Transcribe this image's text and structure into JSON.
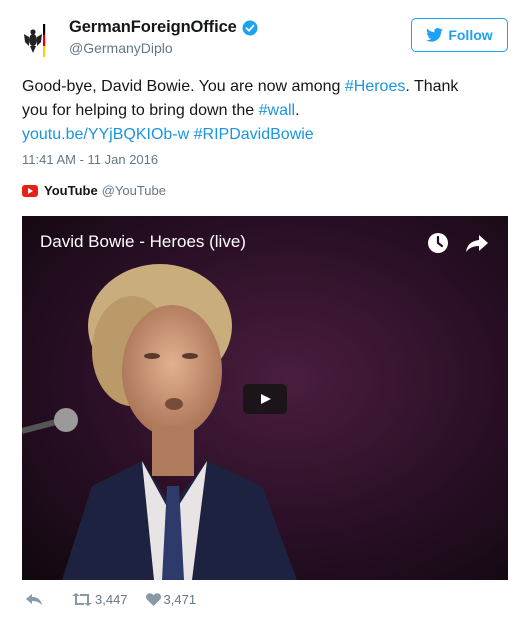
{
  "user": {
    "display_name": "GermanForeignOffice",
    "handle": "@GermanyDiplo",
    "avatar_icon": "eagle-coat-of-arms-icon",
    "verified_icon": "verified-badge-icon"
  },
  "follow_button": {
    "label": "Follow",
    "icon": "twitter-bird-icon"
  },
  "tweet": {
    "line1_text": "Good-bye, David Bowie. You are now among ",
    "line1_hashtag": "#Heroes",
    "line1_tail": ". Thank",
    "line2_text": "you for helping to bring down the ",
    "line2_hashtag": "#wall",
    "line2_tail": ".",
    "line3_link": "youtu.be/YYjBQKIOb-w",
    "line3_hashtag": "#RIPDavidBowie",
    "timestamp": "11:41 AM - 11 Jan 2016"
  },
  "embed": {
    "source_name": "YouTube",
    "source_handle": "@YouTube",
    "video_title": "David Bowie - Heroes (live)",
    "icons": [
      "youtube-logo-icon",
      "clock-icon",
      "share-arrow-icon",
      "play-icon"
    ]
  },
  "actions": {
    "retweets": "3,447",
    "likes": "3,471",
    "icons": [
      "reply-icon",
      "retweet-icon",
      "heart-icon"
    ]
  },
  "colors": {
    "link": "#1b95e0",
    "follow": "#1da1f2",
    "muted": "#657786",
    "youtube_red": "#e62117"
  }
}
